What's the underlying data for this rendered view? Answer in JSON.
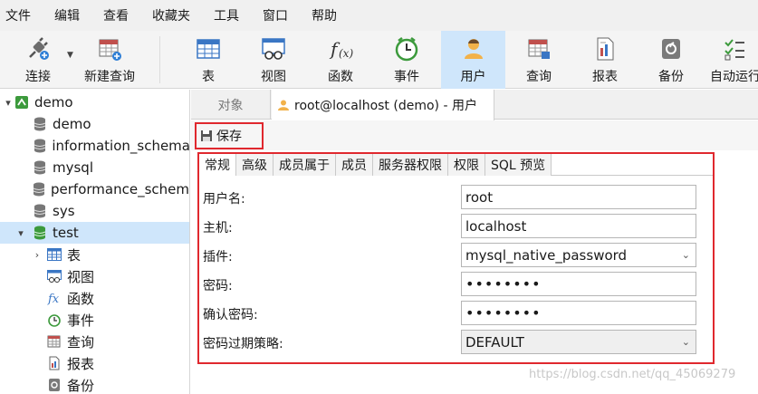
{
  "menu": [
    "文件",
    "编辑",
    "查看",
    "收藏夹",
    "工具",
    "窗口",
    "帮助"
  ],
  "toolbar": {
    "connect": "连接",
    "new_query": "新建查询",
    "table": "表",
    "view": "视图",
    "function": "函数",
    "event": "事件",
    "user": "用户",
    "query": "查询",
    "report": "报表",
    "backup": "备份",
    "auto_run": "自动运行"
  },
  "sidebar": {
    "connection": "demo",
    "databases": [
      "demo",
      "information_schema",
      "mysql",
      "performance_schema",
      "sys",
      "test"
    ],
    "test_children": [
      "表",
      "视图",
      "函数",
      "事件",
      "查询",
      "报表",
      "备份"
    ]
  },
  "tabs": {
    "objects": "对象",
    "user_tab": "root@localhost (demo) - 用户"
  },
  "save_label": "保存",
  "subtabs": [
    "常规",
    "高级",
    "成员属于",
    "成员",
    "服务器权限",
    "权限",
    "SQL 预览"
  ],
  "form": {
    "username_label": "用户名:",
    "username_value": "root",
    "host_label": "主机:",
    "host_value": "localhost",
    "plugin_label": "插件:",
    "plugin_value": "mysql_native_password",
    "password_label": "密码:",
    "password_value": "••••••••",
    "confirm_label": "确认密码:",
    "confirm_value": "••••••••",
    "expire_label": "密码过期策略:",
    "expire_value": "DEFAULT"
  },
  "watermark": "https://blog.csdn.net/qq_45069279",
  "colors": {
    "accent": "#cfe6fb",
    "highlight_border": "#e0282e"
  }
}
